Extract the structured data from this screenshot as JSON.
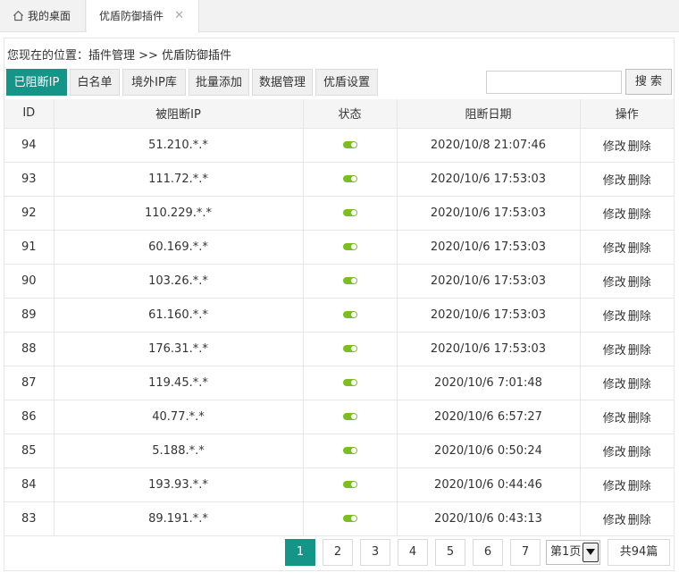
{
  "tabs": {
    "home": {
      "label": "我的桌面",
      "icon": "home-icon"
    },
    "active": {
      "label": "优盾防御插件",
      "close": "✕"
    }
  },
  "breadcrumb": "您现在的位置：插件管理 >> 优盾防御插件",
  "toolbar": {
    "buttons": [
      "已阻断IP",
      "白名单",
      "境外IP库",
      "批量添加",
      "数据管理",
      "优盾设置"
    ],
    "active_index": 0,
    "search_value": "",
    "search_label": "搜 索"
  },
  "table": {
    "headers": [
      "ID",
      "被阻断IP",
      "状态",
      "阻断日期",
      "操作"
    ],
    "rows": [
      {
        "id": "94",
        "ip": "51.210.*.*",
        "date": "2020/10/8 21:07:46"
      },
      {
        "id": "93",
        "ip": "111.72.*.*",
        "date": "2020/10/6 17:53:03"
      },
      {
        "id": "92",
        "ip": "110.229.*.*",
        "date": "2020/10/6 17:53:03"
      },
      {
        "id": "91",
        "ip": "60.169.*.*",
        "date": "2020/10/6 17:53:03"
      },
      {
        "id": "90",
        "ip": "103.26.*.*",
        "date": "2020/10/6 17:53:03"
      },
      {
        "id": "89",
        "ip": "61.160.*.*",
        "date": "2020/10/6 17:53:03"
      },
      {
        "id": "88",
        "ip": "176.31.*.*",
        "date": "2020/10/6 17:53:03"
      },
      {
        "id": "87",
        "ip": "119.45.*.*",
        "date": "2020/10/6 7:01:48"
      },
      {
        "id": "86",
        "ip": "40.77.*.*",
        "date": "2020/10/6 6:57:27"
      },
      {
        "id": "85",
        "ip": "5.188.*.*",
        "date": "2020/10/6 0:50:24"
      },
      {
        "id": "84",
        "ip": "193.93.*.*",
        "date": "2020/10/6 0:44:46"
      },
      {
        "id": "83",
        "ip": "89.191.*.*",
        "date": "2020/10/6 0:43:13"
      }
    ],
    "edit_label": "修改",
    "delete_label": "删除",
    "status_color": "#7cbd22"
  },
  "pagination": {
    "pages": [
      "1",
      "2",
      "3",
      "4",
      "5",
      "6",
      "7"
    ],
    "current": "1",
    "select_value": "第1页",
    "total": "共94篇"
  },
  "colors": {
    "accent": "#159488"
  }
}
